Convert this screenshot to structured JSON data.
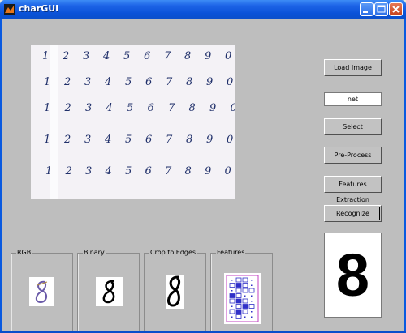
{
  "window": {
    "title": "charGUI"
  },
  "controls": {
    "load_image": "Load Image",
    "method_value": "net",
    "select": "Select",
    "pre_process": "Pre-Process",
    "features_extraction": "Features Extraction",
    "recognize": "Recognize"
  },
  "panels": {
    "rgb": "RGB",
    "binary": "Binary",
    "crop": "Crop to Edges",
    "features": "Features"
  },
  "result": {
    "digit": "8"
  },
  "sample_sheet": {
    "rows": [
      [
        "1",
        "2",
        "3",
        "4",
        "5",
        "6",
        "7",
        "8",
        "9",
        "0"
      ],
      [
        "1",
        "2",
        "3",
        "4",
        "5",
        "6",
        "7",
        "8",
        "9",
        "0"
      ],
      [
        "1",
        "2",
        "3",
        "4",
        "5",
        "6",
        "7",
        "8",
        "9",
        "0"
      ],
      [
        "1",
        "2",
        "3",
        "4",
        "5",
        "6",
        "7",
        "8",
        "9",
        "0"
      ],
      [
        "1",
        "2",
        "3",
        "4",
        "5",
        "6",
        "7",
        "8",
        "9",
        "0"
      ]
    ]
  },
  "colors": {
    "ink": "#20306a",
    "features_grid": "#c040c0",
    "features_cells": "#3030c8"
  }
}
